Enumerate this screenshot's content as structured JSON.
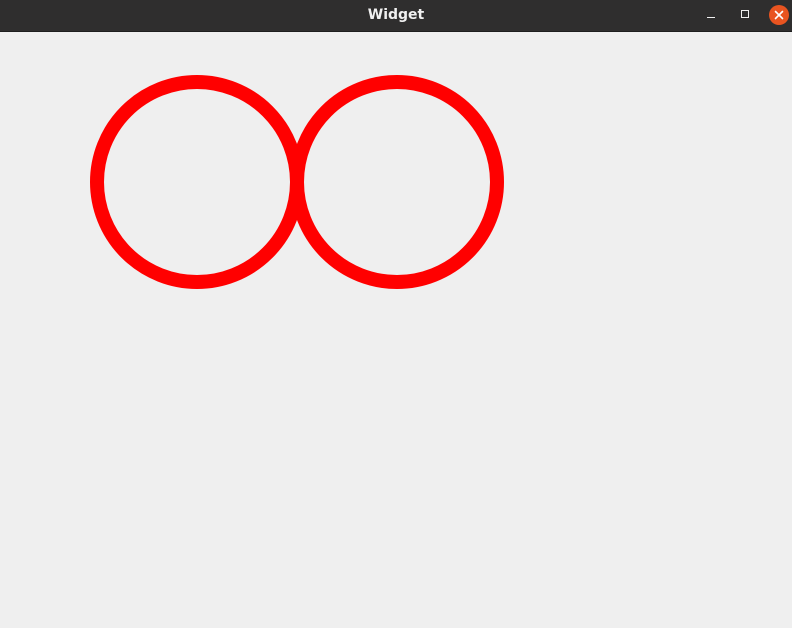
{
  "window": {
    "title": "Widget"
  },
  "titlebar_buttons": {
    "minimize_icon": "minimize-icon",
    "maximize_icon": "maximize-icon",
    "close_icon": "close-icon",
    "close_color": "#e95420"
  },
  "canvas": {
    "shape_color": "#ff0000",
    "background_color": "#efefef"
  }
}
